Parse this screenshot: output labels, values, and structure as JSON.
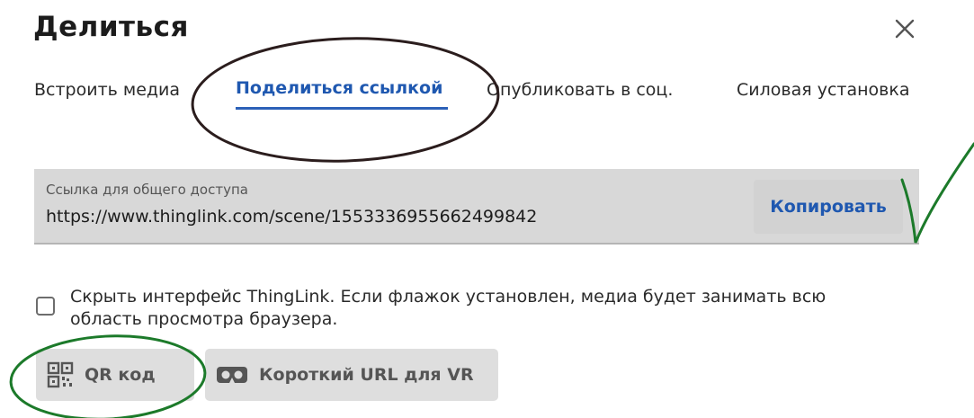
{
  "dialog": {
    "title": "Делиться",
    "close_icon": "close-icon"
  },
  "tabs": [
    {
      "label": "Встроить медиа",
      "active": false
    },
    {
      "label": "Поделиться ссылкой",
      "active": true
    },
    {
      "label": "Опубликовать в соц.",
      "active": false
    },
    {
      "label": "Силовая установка",
      "active": false
    }
  ],
  "share_link": {
    "label": "Ссылка для общего доступа",
    "url": "https://www.thinglink.com/scene/1553336955662499842",
    "copy_label": "Копировать"
  },
  "hide_interface": {
    "checked": false,
    "label": "Скрыть интерфейс ThingLink. Если флажок установлен, медиа будет занимать всю область просмотра браузера."
  },
  "actions": {
    "qr_label": "QR код",
    "qr_icon": "qr-code-icon",
    "vr_label": "Короткий URL для VR",
    "vr_icon": "vr-headset-icon"
  },
  "colors": {
    "accent": "#1f58b0",
    "annotation_dark": "#2b1d1d",
    "annotation_green": "#1c7a2a"
  }
}
